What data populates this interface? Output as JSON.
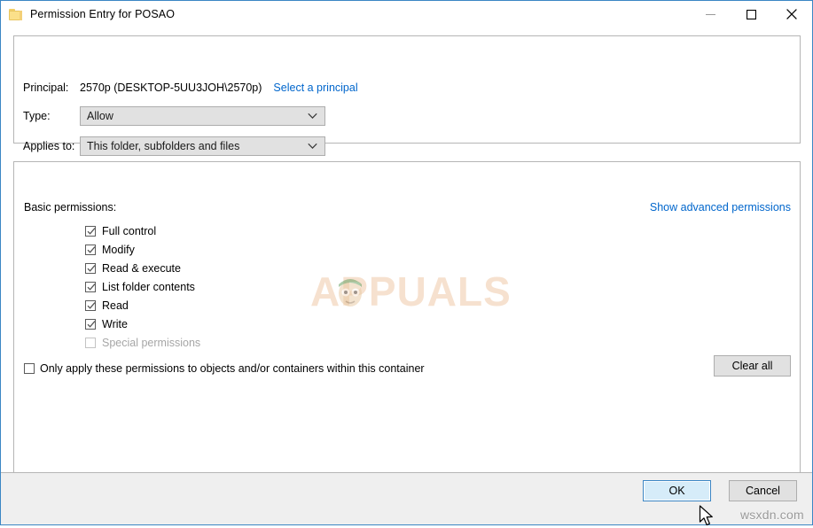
{
  "window": {
    "title": "Permission Entry for POSAO",
    "icon": "folder-icon",
    "controls": {
      "minimize": "minimize-icon",
      "maximize": "maximize-icon",
      "close": "close-icon"
    }
  },
  "top_panel": {
    "principal": {
      "label": "Principal:",
      "value": "2570p (DESKTOP-5UU3JOH\\2570p)",
      "link": "Select a principal"
    },
    "type": {
      "label": "Type:",
      "value": "Allow"
    },
    "applies_to": {
      "label": "Applies to:",
      "value": "This folder, subfolders and files"
    }
  },
  "bottom_panel": {
    "basic_permissions_label": "Basic permissions:",
    "show_advanced_link": "Show advanced permissions",
    "permissions": [
      {
        "label": "Full control",
        "checked": true,
        "enabled": true
      },
      {
        "label": "Modify",
        "checked": true,
        "enabled": true
      },
      {
        "label": "Read & execute",
        "checked": true,
        "enabled": true
      },
      {
        "label": "List folder contents",
        "checked": true,
        "enabled": true
      },
      {
        "label": "Read",
        "checked": true,
        "enabled": true
      },
      {
        "label": "Write",
        "checked": true,
        "enabled": true
      },
      {
        "label": "Special permissions",
        "checked": false,
        "enabled": false
      }
    ],
    "only_apply": {
      "label": "Only apply these permissions to objects and/or containers within this container",
      "checked": false
    },
    "clear_all_label": "Clear all"
  },
  "footer": {
    "ok_label": "OK",
    "cancel_label": "Cancel"
  },
  "watermarks": {
    "center": "APPUALS",
    "corner": "wsxdn.com"
  },
  "colors": {
    "window_border": "#3b86c4",
    "link": "#0066cc",
    "panel_border": "#b5b5b5",
    "control_face": "#e1e1e1",
    "footer_bg": "#efefef",
    "focus_fill": "#d6ecf9",
    "disabled_text": "#a6a6a6"
  }
}
